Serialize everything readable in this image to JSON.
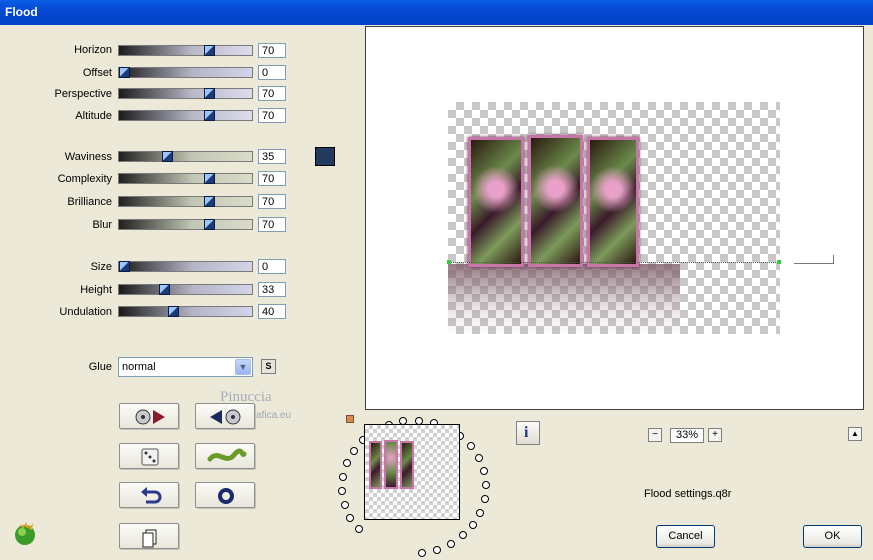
{
  "window": {
    "title": "Flood"
  },
  "params": {
    "horizon": {
      "label": "Horizon",
      "value": "70",
      "fraction": 0.7
    },
    "offset": {
      "label": "Offset",
      "value": "0",
      "fraction": 0.0
    },
    "perspective": {
      "label": "Perspective",
      "value": "70",
      "fraction": 0.7
    },
    "altitude": {
      "label": "Altitude",
      "value": "70",
      "fraction": 0.7
    },
    "waviness": {
      "label": "Waviness",
      "value": "35",
      "fraction": 0.35
    },
    "complexity": {
      "label": "Complexity",
      "value": "70",
      "fraction": 0.7
    },
    "brilliance": {
      "label": "Brilliance",
      "value": "70",
      "fraction": 0.7
    },
    "blur": {
      "label": "Blur",
      "value": "70",
      "fraction": 0.7
    },
    "size": {
      "label": "Size",
      "value": "0",
      "fraction": 0.0
    },
    "height": {
      "label": "Height",
      "value": "33",
      "fraction": 0.33
    },
    "undulation": {
      "label": "Undulation",
      "value": "40",
      "fraction": 0.4
    }
  },
  "color_swatch": "#223a5e",
  "glue": {
    "label": "Glue",
    "value": "normal",
    "s_label": "S"
  },
  "watermark": {
    "line1": "Pinuccia",
    "line2": "www.magiegrafica.eu"
  },
  "zoom": {
    "value": "33%",
    "minus": "−",
    "plus": "+"
  },
  "status": {
    "settings_file": "Flood settings.q8r"
  },
  "buttons": {
    "cancel": "Cancel",
    "ok": "OK",
    "info": "i",
    "scroll_up": "▲"
  }
}
